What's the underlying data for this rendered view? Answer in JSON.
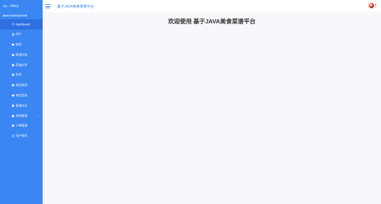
{
  "brand": {
    "logo_text": "ciba◎"
  },
  "sidebar": {
    "nav_title": "MAIN NAVIGATION",
    "items": [
      {
        "label": "Dashboard",
        "icon": "dashboard-icon",
        "active": true
      },
      {
        "label": "用户",
        "icon": "users-icon"
      },
      {
        "label": "商家",
        "icon": "store-icon"
      },
      {
        "label": "菜谱分类",
        "icon": "category-icon"
      },
      {
        "label": "菜谱分享",
        "icon": "share-icon"
      },
      {
        "label": "秒杀",
        "icon": "flash-sale-icon"
      },
      {
        "label": "商品类型",
        "icon": "product-type-icon"
      },
      {
        "label": "商品信息",
        "icon": "product-info-icon"
      },
      {
        "label": "菜谱讨论",
        "icon": "discussion-icon"
      },
      {
        "label": "系统管理",
        "icon": "settings-icon",
        "expandable": true
      },
      {
        "label": "订单管理",
        "icon": "orders-icon",
        "expandable": true
      },
      {
        "label": "用户资料",
        "icon": "profile-icon",
        "expandable": true
      }
    ]
  },
  "header": {
    "title": "基于JAVA美食菜谱平台"
  },
  "main": {
    "welcome_text": "欢迎使用 基于JAVA美食菜谱平台"
  },
  "colors": {
    "accent": "#3a86f3",
    "active": "#2f6fe0",
    "text": "#303133"
  }
}
